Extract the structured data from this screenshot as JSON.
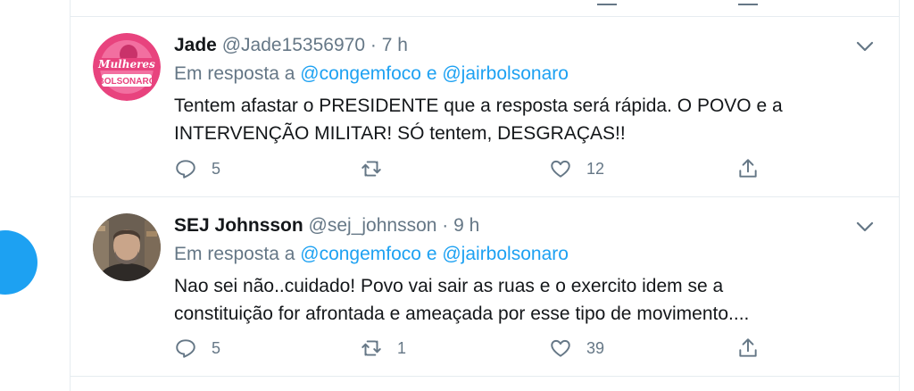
{
  "tweets": [
    {
      "name": "Jade",
      "handle": "@Jade15356970",
      "dot": "·",
      "time": "7 h",
      "reply_prefix": "Em resposta a",
      "reply_user1": "@congemfoco",
      "reply_joiner": "e",
      "reply_user2": "@jairbolsonaro",
      "text_line1": "Tentem afastar o PRESIDENTE que a resposta será rápida. O POVO e a",
      "text_line2": "INTERVENÇÃO MILITAR! SÓ tentem, DESGRAÇAS!!",
      "avatar_text_top": "Mulheres",
      "avatar_text_bottom": "BOLSONARO",
      "reply_count": "5",
      "retweet_count": "",
      "like_count": "12"
    },
    {
      "name": "SEJ Johnsson",
      "handle": "@sej_johnsson",
      "dot": "·",
      "time": "9 h",
      "reply_prefix": "Em resposta a",
      "reply_user1": "@congemfoco",
      "reply_joiner": "e",
      "reply_user2": "@jairbolsonaro",
      "text_line1": "Nao sei não..cuidado! Povo vai sair as ruas e o exercito idem se a",
      "text_line2": "constituição for afrontada e ameaçada por esse tipo de movimento....",
      "reply_count": "5",
      "retweet_count": "1",
      "like_count": "39"
    }
  ],
  "colors": {
    "accent": "#1da1f2",
    "muted": "#657786",
    "text": "#14171a",
    "border": "#e6ecf0",
    "avatar_pink": "#e8437e"
  },
  "icons": [
    "reply-icon",
    "retweet-icon",
    "like-icon",
    "share-icon",
    "chevron-down-icon"
  ]
}
